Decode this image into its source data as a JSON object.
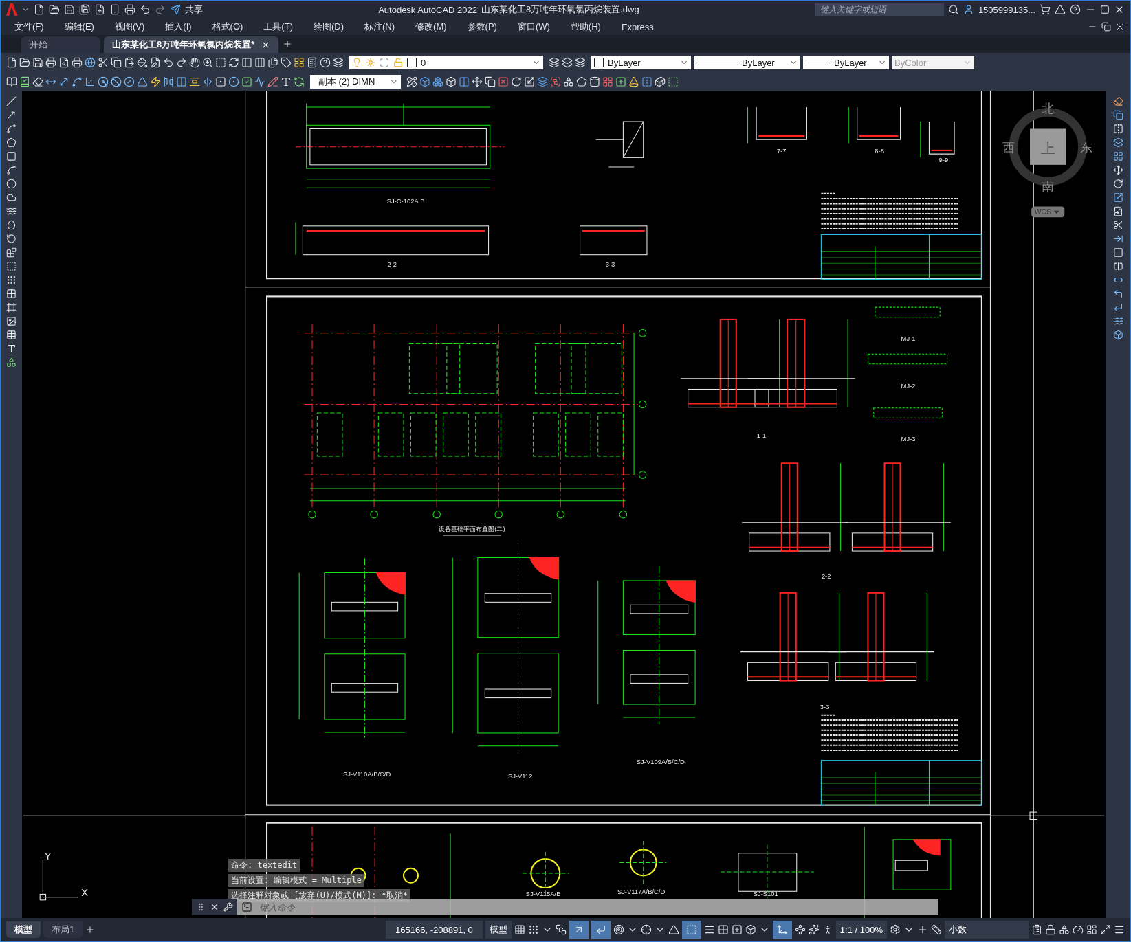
{
  "title_bar": {
    "share": "共享",
    "app_title": "Autodesk AutoCAD 2022",
    "file_name": "山东某化工8万吨年环氧氯丙烷装置.dwg",
    "search": {
      "placeholder": "键入关键字或短语"
    },
    "user": "1505999135..."
  },
  "menu": [
    "文件(F)",
    "编辑(E)",
    "视图(V)",
    "插入(I)",
    "格式(O)",
    "工具(T)",
    "绘图(D)",
    "标注(N)",
    "修改(M)",
    "参数(P)",
    "窗口(W)",
    "帮助(H)",
    "Express"
  ],
  "doc_tabs": [
    {
      "label": "开始",
      "selected": false
    },
    {
      "label": "山东某化工8万吨年环氧氯丙烷装置*",
      "selected": true
    }
  ],
  "properties_toolbar": {
    "layer": "0",
    "color_control": "ByLayer",
    "linetype": "ByLayer",
    "lineweight": "ByLayer",
    "plot_style": {
      "value": "ByColor",
      "disabled": true
    }
  },
  "dim_style": "副本 (2) DIMN",
  "viewcube": {
    "north": "北",
    "west": "西",
    "top": "上",
    "east": "东",
    "south": "南",
    "ucs": "WCS"
  },
  "ucs_axes": {
    "y": "Y",
    "x": "X"
  },
  "drawing_labels": [
    "7-7",
    "8-8",
    "9-9",
    "SJ-C-102A.B",
    "2-2",
    "3-3",
    "MJ-1",
    "MJ-2",
    "1-1",
    "MJ-3",
    "设备基础平面布置图(二)",
    "2-2",
    "3-3",
    "SJ-V109A/B/C/D",
    "SJ-V110A/B/C/D",
    "SJ-V112",
    "SJ-V117A/B/C/D",
    "SJ-V115A/B",
    "SJ-S101"
  ],
  "command_line": {
    "history": [
      "命令: textedit",
      "当前设置: 编辑模式 = Multiple",
      "选择注释对象或 [放弃(U)/模式(M)]: *取消*"
    ],
    "placeholder": "键入命令"
  },
  "layout_tabs": [
    {
      "label": "模型",
      "selected": true
    },
    {
      "label": "布局1",
      "selected": false
    }
  ],
  "status_bar": {
    "coordinates": "165166, -208891, 0",
    "space": "模型",
    "scale": "1:1 / 100%",
    "units": "小数"
  }
}
